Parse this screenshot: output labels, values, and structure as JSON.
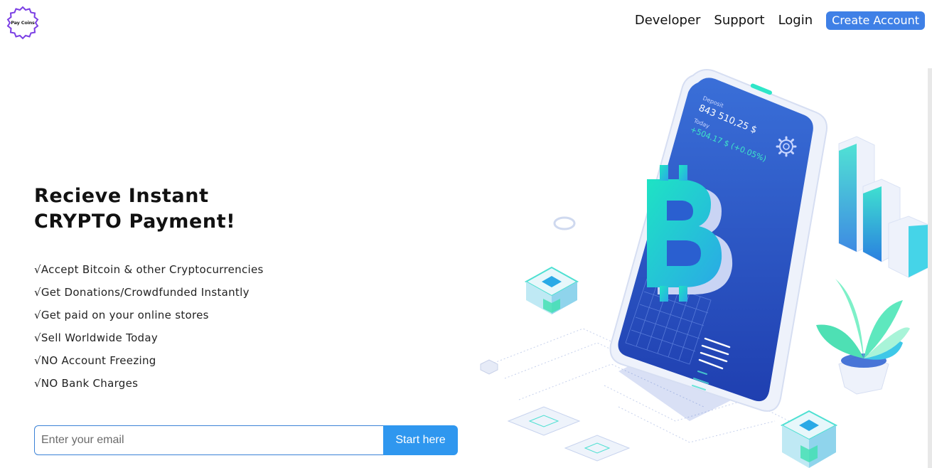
{
  "brand": {
    "name": "Pay Coins",
    "ring_color": "#7b3fe4"
  },
  "nav": {
    "links": [
      "Developer",
      "Support",
      "Login"
    ],
    "cta": "Create Account",
    "cta_color": "#3f80e6"
  },
  "hero": {
    "title_line1": "Recieve Instant",
    "title_line2": "CRYPTO Payment!",
    "features": [
      "√Accept Bitcoin & other Cryptocurrencies",
      "√Get Donations/Crowdfunded Instantly",
      "√Get paid on your online stores",
      "√Sell Worldwide Today",
      "√NO Account Freezing",
      "√NO Bank Charges"
    ],
    "email_placeholder": "Enter your email",
    "submit_label": "Start here",
    "submit_color": "#2f97ef"
  },
  "illustration": {
    "deposit_label": "Deposit",
    "balance": "843 510,25 $",
    "today_label": "Today",
    "change": "+504.17 $ (+0.05%)",
    "icons": [
      "bitcoin-icon",
      "gear-icon",
      "plant-icon",
      "bar-chart-icon"
    ]
  }
}
